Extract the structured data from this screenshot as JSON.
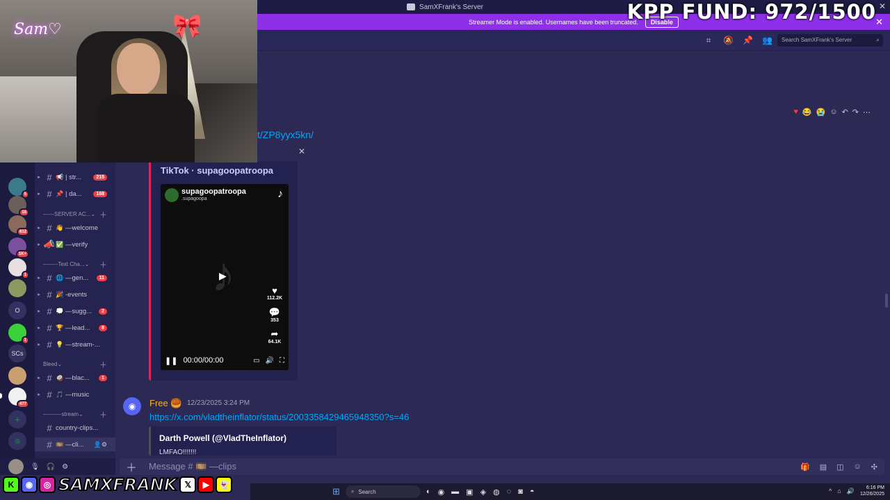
{
  "window": {
    "title": "SamXFrank's Server"
  },
  "banner": {
    "text": "Streamer Mode is enabled. Usernames have been truncated.",
    "button": "Disable"
  },
  "overlay": {
    "fund": "KPP FUND: 972/1500",
    "webcam_logo": "Sam♡"
  },
  "header": {
    "search_placeholder": "Search SamXFrank's Server"
  },
  "servers": [
    {
      "badge": "5"
    },
    {
      "badge": "16"
    },
    {
      "badge": "612"
    },
    {
      "badge": "1K+"
    },
    {
      "badge": "1"
    },
    {
      "badge": ""
    },
    {
      "text": "O"
    },
    {
      "badge": "1"
    },
    {
      "text": "SCs"
    },
    {
      "badge": ""
    },
    {
      "badge": "477"
    }
  ],
  "channels": {
    "items": [
      {
        "emoji": "📢",
        "name": "| str...",
        "badge": "215"
      },
      {
        "emoji": "📌",
        "name": "| da...",
        "badge": "168"
      },
      {
        "emoji": "👋",
        "name": "—welcome"
      },
      {
        "emoji": "✅",
        "name": "—verify"
      },
      {
        "emoji": "🌐",
        "name": "—gen...",
        "badge": "11"
      },
      {
        "emoji": "🎉",
        "name": "-events"
      },
      {
        "emoji": "💭",
        "name": "—sugg...",
        "badge": "2"
      },
      {
        "emoji": "🏆",
        "name": "—lead...",
        "badge": "8"
      },
      {
        "emoji": "💡",
        "name": "—stream-..."
      },
      {
        "emoji": "🥥",
        "name": "—blac...",
        "badge": "1"
      },
      {
        "emoji": "🎵",
        "name": "—music"
      },
      {
        "emoji": "",
        "name": "country-clips..."
      },
      {
        "emoji": "🎞️",
        "name": "—cli..."
      }
    ],
    "categories": [
      "------SERVER AC...",
      "--------Text Cha...",
      "Bleed",
      "----------stream"
    ]
  },
  "chat": {
    "partial_link": "t/ZP8yyx5kn/",
    "embed": {
      "title": "TikTok · supagoopatroopa",
      "author": "supagoopatroopa",
      "handle": ".supagoopa",
      "likes": "112.2K",
      "comments": "353",
      "shares": "64.1K",
      "time": "00:00/00:00"
    },
    "message2": {
      "username": "Free 🥮",
      "timestamp": "12/23/2025 3:24 PM",
      "url": "https://x.com/vladtheinflator/status/2003358429465948350?s=46",
      "embed_title": "Darth Powell (@VladTheInflator)",
      "embed_desc": "LMFAO!!!!!!!"
    },
    "composer_placeholder": "Message # 🎞️ —clips"
  },
  "socials": {
    "name": "SAMXFRANK"
  },
  "taskbar": {
    "search": "Search",
    "time": "6:16 PM",
    "date": "12/26/2025"
  }
}
